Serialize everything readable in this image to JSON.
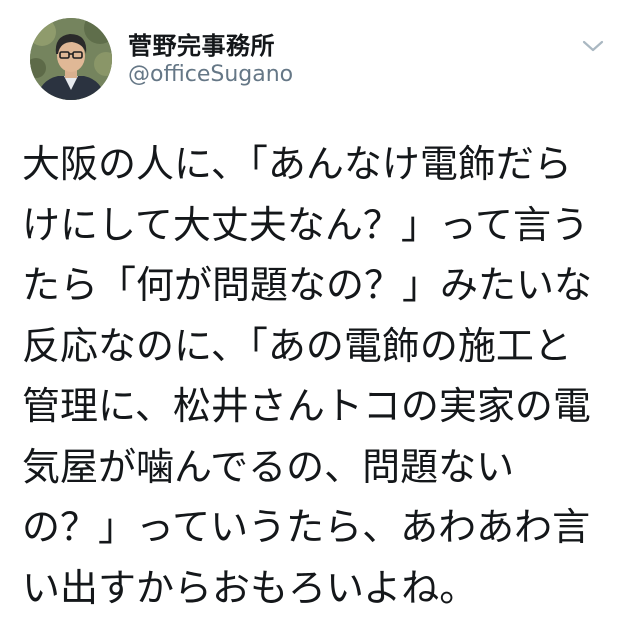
{
  "author": {
    "display_name": "菅野完事務所",
    "handle": "@officeSugano",
    "avatar_icon": "profile-photo"
  },
  "menu_icon": "chevron-down-icon",
  "tweet": {
    "text": "大阪の人に、「あんなけ電飾だら\nけにして大丈夫なん？」って言う\nたら「何が問題なの？」みたいな\n反応なのに、「あの電飾の施工と\n管理に、松井さんトコの実家の電\n気屋が噛んでるの、問題ない\nの？」っていうたら、あわあわ言\nい出すからおもろいよね。"
  },
  "colors": {
    "text": "#14171a",
    "secondary": "#657786",
    "chevron": "#aab8c2"
  }
}
